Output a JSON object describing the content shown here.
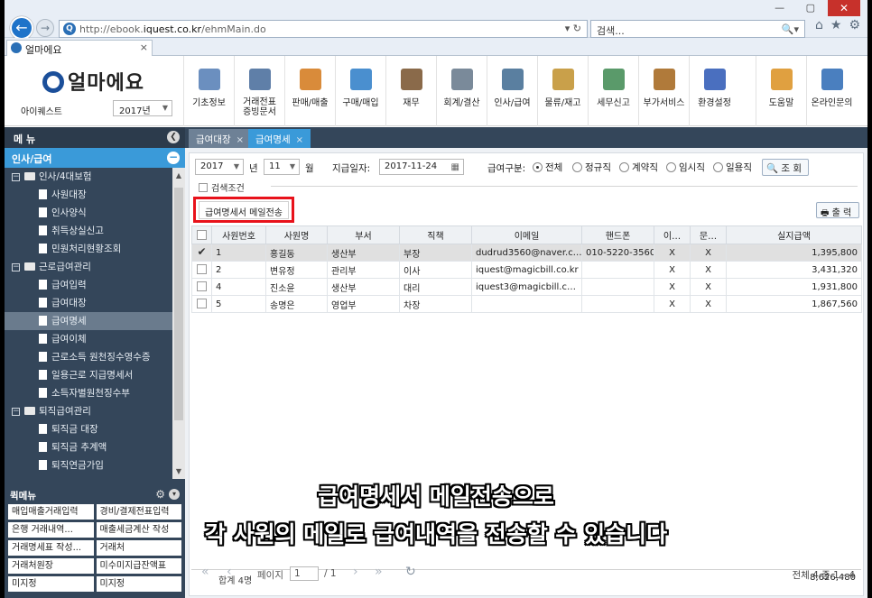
{
  "browser": {
    "url_prefix": "http://ebook.",
    "url_domain": "iquest.co.kr",
    "url_path": "/ehmMain.do",
    "url_controls": "▾ ↻",
    "search_placeholder": "검색...",
    "search_controls": "🔍▾",
    "tab_title": "얼마에요",
    "tab_close": "×",
    "win_icons": "⌂★⚙",
    "win_close": "✕",
    "win_minmax": "— ▢"
  },
  "header": {
    "logo_text": "얼마에요",
    "company": "아이퀘스트",
    "year": "2017년",
    "menus": [
      {
        "label": "기초정보",
        "color": "#6b8fbf"
      },
      {
        "label": "거래전표\n증빙문서",
        "color": "#5f7fa8"
      },
      {
        "label": "판매/매출",
        "color": "#d98b3a"
      },
      {
        "label": "구매/매입",
        "color": "#4a8fcf"
      },
      {
        "label": "재무",
        "color": "#8a6a4a"
      },
      {
        "label": "회계/결산",
        "color": "#7a8a9a"
      },
      {
        "label": "인사/급여",
        "color": "#5a7fa0"
      },
      {
        "label": "물류/재고",
        "color": "#c9a04a"
      },
      {
        "label": "세무신고",
        "color": "#5a9a6a"
      },
      {
        "label": "부가서비스",
        "color": "#b07a3a"
      },
      {
        "label": "환경설정",
        "color": "#4a6fbf"
      }
    ],
    "menus_right": [
      {
        "label": "도움말",
        "color": "#e0a040"
      },
      {
        "label": "온라인문의",
        "color": "#4a7fbf"
      }
    ]
  },
  "sidebar": {
    "title": "메 뉴",
    "collapse_icon": "❮",
    "section": "인사/급여",
    "section_icon": "−",
    "tree": [
      {
        "level": 0,
        "type": "folder",
        "label": "인사/4대보험",
        "selected": false
      },
      {
        "level": 1,
        "type": "doc",
        "label": "사원대장",
        "selected": false
      },
      {
        "level": 1,
        "type": "doc",
        "label": "인사양식",
        "selected": false
      },
      {
        "level": 1,
        "type": "doc",
        "label": "취득상실신고",
        "selected": false
      },
      {
        "level": 1,
        "type": "doc",
        "label": "민원처리현황조회",
        "selected": false
      },
      {
        "level": 0,
        "type": "folder",
        "label": "근로급여관리",
        "selected": false
      },
      {
        "level": 1,
        "type": "doc",
        "label": "급여입력",
        "selected": false
      },
      {
        "level": 1,
        "type": "doc",
        "label": "급여대장",
        "selected": false
      },
      {
        "level": 1,
        "type": "doc",
        "label": "급여명세",
        "selected": true
      },
      {
        "level": 1,
        "type": "doc",
        "label": "급여이체",
        "selected": false
      },
      {
        "level": 1,
        "type": "doc",
        "label": "근로소득 원천징수영수증",
        "selected": false
      },
      {
        "level": 1,
        "type": "doc",
        "label": "일용근로 지급명세서",
        "selected": false
      },
      {
        "level": 1,
        "type": "doc",
        "label": "소득자별원천징수부",
        "selected": false
      },
      {
        "level": 0,
        "type": "folder",
        "label": "퇴직급여관리",
        "selected": false
      },
      {
        "level": 1,
        "type": "doc",
        "label": "퇴직금 대장",
        "selected": false
      },
      {
        "level": 1,
        "type": "doc",
        "label": "퇴직금 추계액",
        "selected": false
      },
      {
        "level": 1,
        "type": "doc",
        "label": "퇴직연금가입",
        "selected": false
      }
    ],
    "quick_title": "퀵메뉴",
    "quick_gear": "⚙",
    "quick_toggle": "▾",
    "quick_items": [
      "매입매출거래입력",
      "경비/결제전표입력",
      "은행 거래내역...",
      "매출세금계산 작성",
      "거래명세표 작성...",
      "거래처",
      "거래처원장",
      "미수미지급잔액표",
      "미지정",
      "미지정"
    ]
  },
  "tabs": [
    {
      "label": "급여대장",
      "active": false,
      "close": "×"
    },
    {
      "label": "급여명세",
      "active": true,
      "close": "×"
    }
  ],
  "filter": {
    "year": "2017",
    "year_unit": "년",
    "month": "11",
    "month_unit": "월",
    "pay_date_label": "지급일자:",
    "pay_date": "2017-11-24",
    "pay_type_label": "급여구분:",
    "options": [
      {
        "label": "전체",
        "checked": true
      },
      {
        "label": "정규직",
        "checked": false
      },
      {
        "label": "계약직",
        "checked": false
      },
      {
        "label": "임시직",
        "checked": false
      },
      {
        "label": "일용직",
        "checked": false
      }
    ],
    "query_button": "조 회",
    "search_condition": "검색조건"
  },
  "actions": {
    "mail_button": "급여명세서 메일전송",
    "print_button": "출 력"
  },
  "table": {
    "columns": [
      "",
      "사원번호",
      "사원명",
      "부서",
      "직책",
      "이메일",
      "핸드폰",
      "이…",
      "문…",
      "실지급액"
    ],
    "rows": [
      {
        "checked": true,
        "selected": true,
        "no": "1",
        "name": "홍길동",
        "dept": "생산부",
        "title": "부장",
        "email": "dudrud3560@naver.c…",
        "phone": "010-5220-3560",
        "e": "X",
        "m": "X",
        "amount": "1,395,800"
      },
      {
        "checked": false,
        "selected": false,
        "no": "2",
        "name": "변유정",
        "dept": "관리부",
        "title": "이사",
        "email": "iquest@magicbill.co.kr",
        "phone": "",
        "e": "X",
        "m": "X",
        "amount": "3,431,320"
      },
      {
        "checked": false,
        "selected": false,
        "no": "4",
        "name": "진소윤",
        "dept": "생산부",
        "title": "대리",
        "email": "iquest3@magicbill.c…",
        "phone": "",
        "e": "X",
        "m": "X",
        "amount": "1,931,800"
      },
      {
        "checked": false,
        "selected": false,
        "no": "5",
        "name": "송명은",
        "dept": "영업부",
        "title": "차장",
        "email": "",
        "phone": "",
        "e": "X",
        "m": "X",
        "amount": "1,867,560"
      }
    ],
    "total_label": "합계 4명",
    "total_amount": "8,626,480"
  },
  "pager": {
    "first": "«",
    "prev": "‹",
    "page_label": "페이지",
    "page": "1",
    "page_total": "/ 1",
    "next": "›",
    "last": "»",
    "refresh": "↻",
    "summary": "전체 4 중 1 - 4"
  },
  "caption": {
    "line1": "급여명세서 메일전송으로",
    "line2": "각 사원의 메일로 급여내역을 전송할 수 있습니다"
  }
}
